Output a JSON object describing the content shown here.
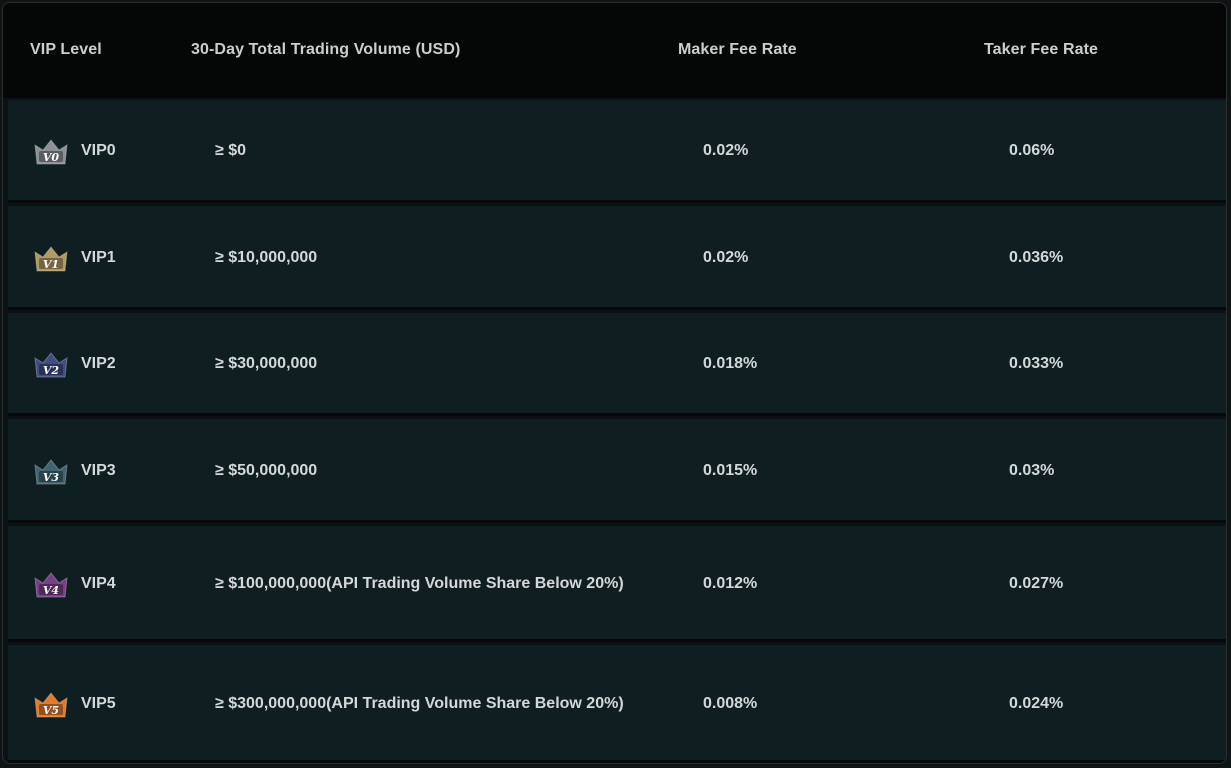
{
  "table": {
    "headers": {
      "vip_level": "VIP Level",
      "volume": "30-Day Total Trading Volume (USD)",
      "maker": "Maker Fee Rate",
      "taker": "Taker Fee Rate"
    },
    "rows": [
      {
        "badge_text": "V0",
        "badge_color": "#8d9196",
        "level": "VIP0",
        "volume": "≥ $0",
        "maker": "0.02%",
        "taker": "0.06%"
      },
      {
        "badge_text": "V1",
        "badge_color": "#b39a63",
        "level": "VIP1",
        "volume": "≥ $10,000,000",
        "maker": "0.02%",
        "taker": "0.036%"
      },
      {
        "badge_text": "V2",
        "badge_color": "#3e4d86",
        "level": "VIP2",
        "volume": "≥ $30,000,000",
        "maker": "0.018%",
        "taker": "0.033%"
      },
      {
        "badge_text": "V3",
        "badge_color": "#3f6670",
        "level": "VIP3",
        "volume": "≥ $50,000,000",
        "maker": "0.015%",
        "taker": "0.03%"
      },
      {
        "badge_text": "V4",
        "badge_color": "#7a3f86",
        "level": "VIP4",
        "volume": "≥ $100,000,000(API Trading Volume Share Below 20%)",
        "maker": "0.012%",
        "taker": "0.027%"
      },
      {
        "badge_text": "V5",
        "badge_color": "#e37a2c",
        "level": "VIP5",
        "volume": "≥ $300,000,000(API Trading Volume Share Below 20%)",
        "maker": "0.008%",
        "taker": "0.024%"
      }
    ]
  }
}
